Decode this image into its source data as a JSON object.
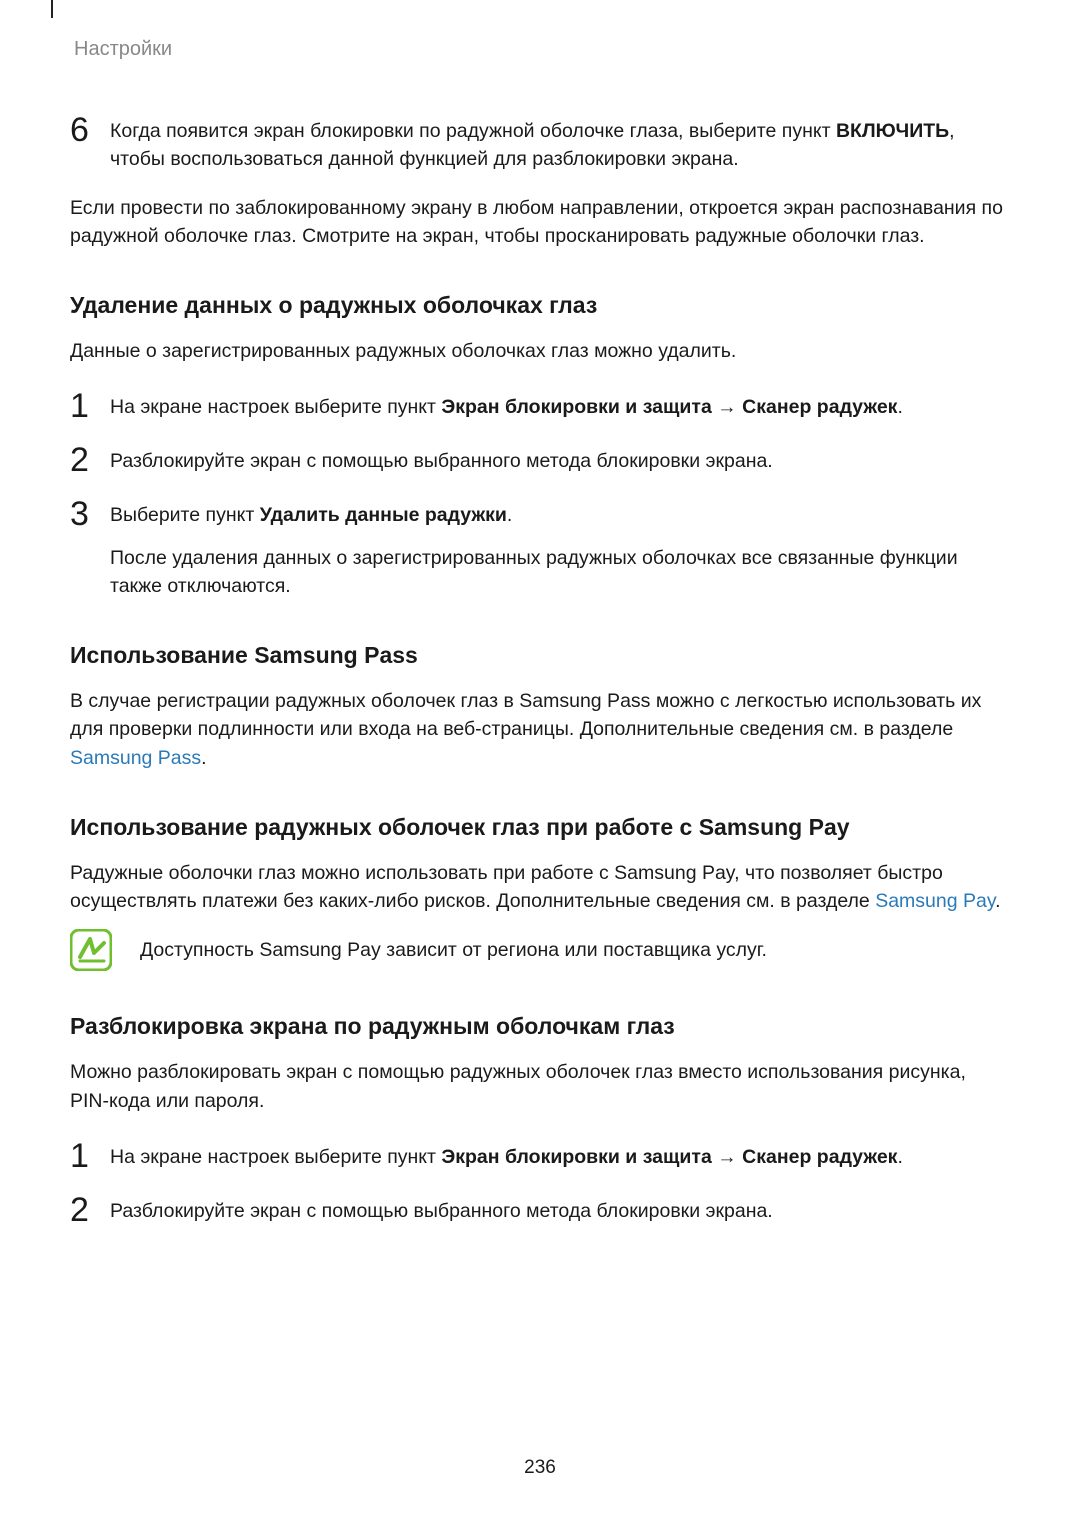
{
  "header": "Настройки",
  "page_number": "236",
  "step6": {
    "num": "6",
    "text_a": "Когда появится экран блокировки по радужной оболочке глаза, выберите пункт ",
    "text_b": "ВКЛЮЧИТЬ",
    "text_c": ", чтобы воспользоваться данной функцией для разблокировки экрана."
  },
  "after6": "Если провести по заблокированному экрану в любом направлении, откроется экран распознавания по радужной оболочке глаз. Смотрите на экран, чтобы просканировать радужные оболочки глаз.",
  "sec1": {
    "heading": "Удаление данных о радужных оболочках глаз",
    "intro": "Данные о зарегистрированных радужных оболочках глаз можно удалить.",
    "s1": {
      "num": "1",
      "a": "На экране настроек выберите пункт ",
      "b": "Экран блокировки и защита",
      "arrow": " → ",
      "c": "Сканер радужек",
      "d": "."
    },
    "s2": {
      "num": "2",
      "a": "Разблокируйте экран с помощью выбранного метода блокировки экрана."
    },
    "s3": {
      "num": "3",
      "a": "Выберите пункт ",
      "b": "Удалить данные радужки",
      "c": ".",
      "after": "После удаления данных о зарегистрированных радужных оболочках все связанные функции также отключаются."
    }
  },
  "sec2": {
    "heading": "Использование Samsung Pass",
    "a": "В случае регистрации радужных оболочек глаз в Samsung Pass можно с легкостью использовать их для проверки подлинности или входа на веб-страницы. Дополнительные сведения см. в разделе ",
    "link": "Samsung Pass",
    "b": "."
  },
  "sec3": {
    "heading": "Использование радужных оболочек глаз при работе с Samsung Pay",
    "a": "Радужные оболочки глаз можно использовать при работе с Samsung Pay, что позволяет быстро осуществлять платежи без каких-либо рисков. Дополнительные сведения см. в разделе ",
    "link": "Samsung Pay",
    "b": ".",
    "note": "Доступность Samsung Pay зависит от региона или поставщика услуг."
  },
  "sec4": {
    "heading": "Разблокировка экрана по радужным оболочкам глаз",
    "intro": "Можно разблокировать экран с помощью радужных оболочек глаз вместо использования рисунка, PIN-кода или пароля.",
    "s1": {
      "num": "1",
      "a": "На экране настроек выберите пункт ",
      "b": "Экран блокировки и защита",
      "arrow": " → ",
      "c": "Сканер радужек",
      "d": "."
    },
    "s2": {
      "num": "2",
      "a": "Разблокируйте экран с помощью выбранного метода блокировки экрана."
    }
  }
}
